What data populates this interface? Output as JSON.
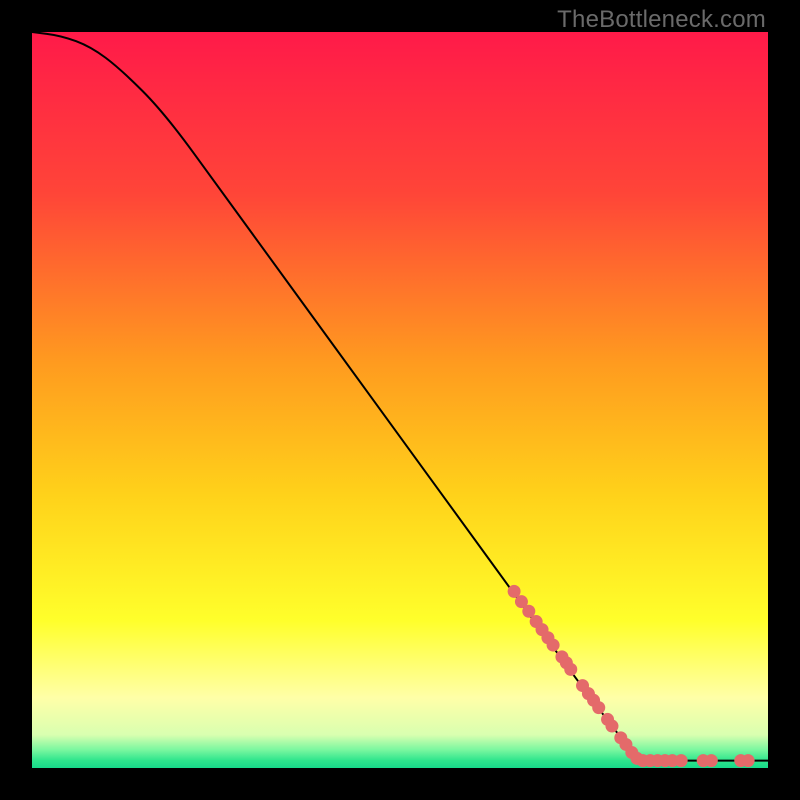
{
  "watermark": "TheBottleneck.com",
  "chart_data": {
    "type": "line",
    "title": "",
    "xlabel": "",
    "ylabel": "",
    "xlim": [
      0,
      100
    ],
    "ylim": [
      0,
      100
    ],
    "curve": {
      "name": "bottleneck-curve",
      "points": [
        {
          "x": 0,
          "y": 100
        },
        {
          "x": 4,
          "y": 99.5
        },
        {
          "x": 8,
          "y": 98
        },
        {
          "x": 12,
          "y": 95
        },
        {
          "x": 18,
          "y": 89
        },
        {
          "x": 26,
          "y": 78
        },
        {
          "x": 34,
          "y": 67
        },
        {
          "x": 42,
          "y": 56
        },
        {
          "x": 50,
          "y": 45
        },
        {
          "x": 58,
          "y": 34
        },
        {
          "x": 66,
          "y": 23
        },
        {
          "x": 74,
          "y": 12
        },
        {
          "x": 82,
          "y": 1.5
        },
        {
          "x": 83,
          "y": 1.0
        },
        {
          "x": 100,
          "y": 1.0
        }
      ]
    },
    "markers": {
      "name": "highlighted-points",
      "color": "#e46a6a",
      "radius": 6.5,
      "points": [
        {
          "x": 65.5,
          "y": 24.0
        },
        {
          "x": 66.5,
          "y": 22.6
        },
        {
          "x": 67.5,
          "y": 21.3
        },
        {
          "x": 68.5,
          "y": 19.9
        },
        {
          "x": 69.3,
          "y": 18.8
        },
        {
          "x": 70.1,
          "y": 17.7
        },
        {
          "x": 70.8,
          "y": 16.7
        },
        {
          "x": 72.0,
          "y": 15.1
        },
        {
          "x": 72.6,
          "y": 14.3
        },
        {
          "x": 73.2,
          "y": 13.4
        },
        {
          "x": 74.8,
          "y": 11.2
        },
        {
          "x": 75.6,
          "y": 10.1
        },
        {
          "x": 76.3,
          "y": 9.2
        },
        {
          "x": 77.0,
          "y": 8.2
        },
        {
          "x": 78.2,
          "y": 6.6
        },
        {
          "x": 78.8,
          "y": 5.7
        },
        {
          "x": 80.0,
          "y": 4.1
        },
        {
          "x": 80.7,
          "y": 3.2
        },
        {
          "x": 81.5,
          "y": 2.1
        },
        {
          "x": 82.2,
          "y": 1.3
        },
        {
          "x": 83.0,
          "y": 1.0
        },
        {
          "x": 84.0,
          "y": 1.0
        },
        {
          "x": 85.0,
          "y": 1.0
        },
        {
          "x": 86.0,
          "y": 1.0
        },
        {
          "x": 87.0,
          "y": 1.0
        },
        {
          "x": 88.2,
          "y": 1.0
        },
        {
          "x": 91.2,
          "y": 1.0
        },
        {
          "x": 92.3,
          "y": 1.0
        },
        {
          "x": 96.3,
          "y": 1.0
        },
        {
          "x": 97.3,
          "y": 1.0
        }
      ]
    },
    "gradient_stops": [
      {
        "offset": 0,
        "color": "#ff1a49"
      },
      {
        "offset": 0.22,
        "color": "#ff4538"
      },
      {
        "offset": 0.45,
        "color": "#ff9b1f"
      },
      {
        "offset": 0.63,
        "color": "#ffd21a"
      },
      {
        "offset": 0.8,
        "color": "#ffff2b"
      },
      {
        "offset": 0.905,
        "color": "#ffffa8"
      },
      {
        "offset": 0.955,
        "color": "#d9ffb0"
      },
      {
        "offset": 0.975,
        "color": "#7bf7a0"
      },
      {
        "offset": 0.99,
        "color": "#2de58c"
      },
      {
        "offset": 1.0,
        "color": "#17d98a"
      }
    ]
  }
}
